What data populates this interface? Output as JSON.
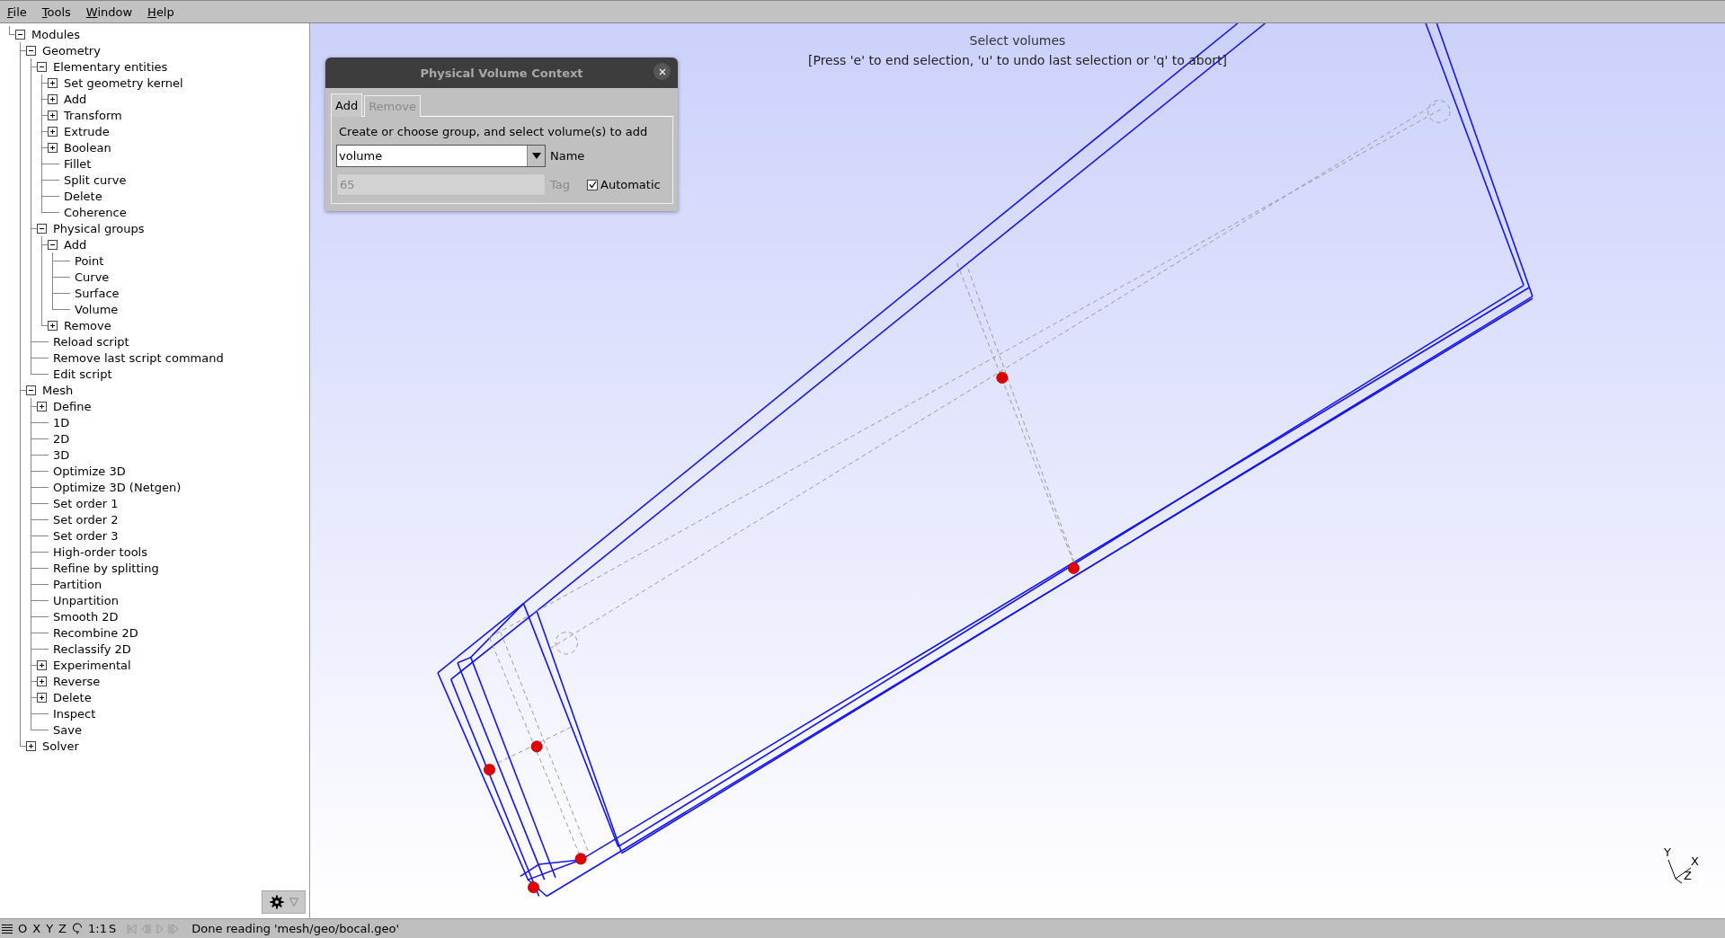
{
  "menu": [
    "File",
    "Tools",
    "Window",
    "Help"
  ],
  "tree": [
    {
      "label": "Modules",
      "expanded": true,
      "children": [
        {
          "label": "Geometry",
          "expanded": true,
          "children": [
            {
              "label": "Elementary entities",
              "expanded": true,
              "children": [
                {
                  "label": "Set geometry kernel",
                  "expanded": false
                },
                {
                  "label": "Add",
                  "expanded": false
                },
                {
                  "label": "Transform",
                  "expanded": false
                },
                {
                  "label": "Extrude",
                  "expanded": false
                },
                {
                  "label": "Boolean",
                  "expanded": false
                },
                {
                  "label": "Fillet"
                },
                {
                  "label": "Split curve"
                },
                {
                  "label": "Delete"
                },
                {
                  "label": "Coherence"
                }
              ]
            },
            {
              "label": "Physical groups",
              "expanded": true,
              "children": [
                {
                  "label": "Add",
                  "expanded": true,
                  "children": [
                    {
                      "label": "Point"
                    },
                    {
                      "label": "Curve"
                    },
                    {
                      "label": "Surface"
                    },
                    {
                      "label": "Volume"
                    }
                  ]
                },
                {
                  "label": "Remove",
                  "expanded": false
                }
              ]
            },
            {
              "label": "Reload script"
            },
            {
              "label": "Remove last script command"
            },
            {
              "label": "Edit script"
            }
          ]
        },
        {
          "label": "Mesh",
          "expanded": true,
          "children": [
            {
              "label": "Define",
              "expanded": false
            },
            {
              "label": "1D"
            },
            {
              "label": "2D"
            },
            {
              "label": "3D"
            },
            {
              "label": "Optimize 3D"
            },
            {
              "label": "Optimize 3D (Netgen)"
            },
            {
              "label": "Set order 1"
            },
            {
              "label": "Set order 2"
            },
            {
              "label": "Set order 3"
            },
            {
              "label": "High-order tools"
            },
            {
              "label": "Refine by splitting"
            },
            {
              "label": "Partition"
            },
            {
              "label": "Unpartition"
            },
            {
              "label": "Smooth 2D"
            },
            {
              "label": "Recombine 2D"
            },
            {
              "label": "Reclassify 2D"
            },
            {
              "label": "Experimental",
              "expanded": false
            },
            {
              "label": "Reverse",
              "expanded": false
            },
            {
              "label": "Delete",
              "expanded": false
            },
            {
              "label": "Inspect"
            },
            {
              "label": "Save"
            }
          ]
        },
        {
          "label": "Solver",
          "expanded": false
        }
      ]
    }
  ],
  "viewport": {
    "title": "Select volumes",
    "instructions": "[Press 'e' to end selection, 'u' to undo last selection or 'q' to abort]",
    "axes": [
      {
        "label": "Y"
      },
      {
        "label": "X"
      },
      {
        "label": "Z"
      }
    ]
  },
  "dialog": {
    "title": "Physical Volume Context",
    "tabs": [
      {
        "label": "Add",
        "selected": true,
        "disabled": false
      },
      {
        "label": "Remove",
        "selected": false,
        "disabled": true
      }
    ],
    "hint": "Create or choose group, and select volume(s) to add",
    "name_field": {
      "value": "volume",
      "label": "Name"
    },
    "tag_field": {
      "value": "65",
      "label": "Tag",
      "disabled": true
    },
    "automatic": {
      "label": "Automatic",
      "checked": true
    }
  },
  "status_bar": {
    "view_buttons": [
      "O",
      "X",
      "Y",
      "Z"
    ],
    "scale_button": "1:1",
    "s_button": "S",
    "message": "Done reading 'mesh/geo/bocal.geo'"
  }
}
